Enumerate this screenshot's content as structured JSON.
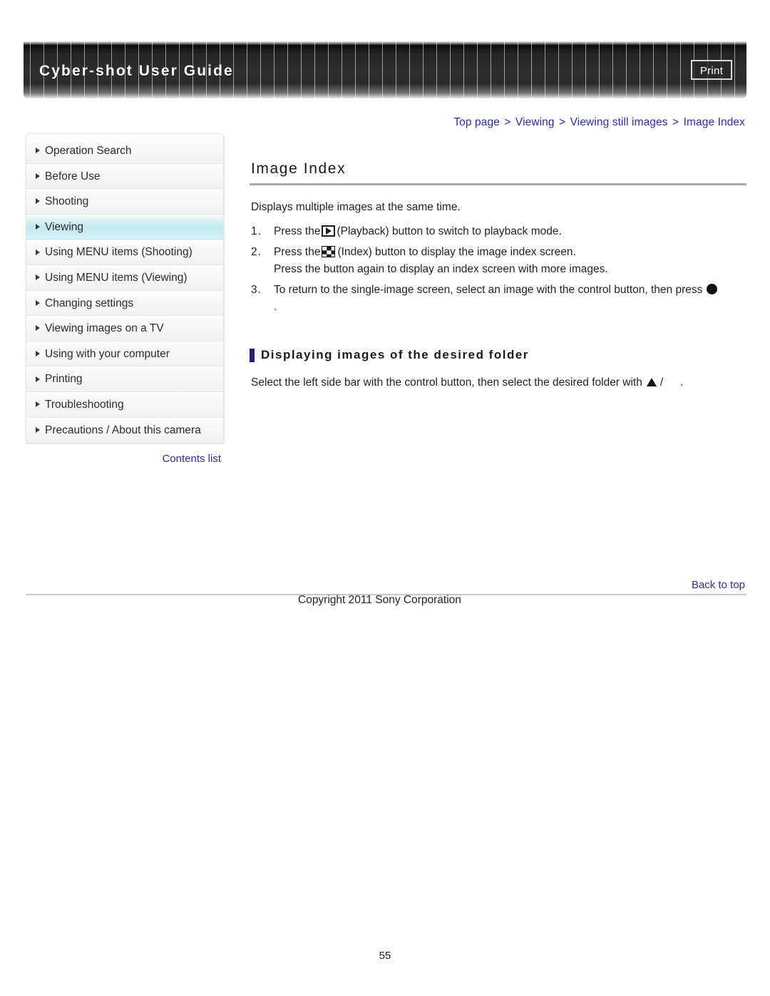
{
  "header": {
    "title": "Cyber-shot User Guide",
    "print_label": "Print"
  },
  "breadcrumb": {
    "items": [
      "Top page",
      "Viewing",
      "Viewing still images",
      "Image Index"
    ],
    "separator": ">"
  },
  "sidebar": {
    "items": [
      {
        "label": "Operation Search",
        "active": false
      },
      {
        "label": "Before Use",
        "active": false
      },
      {
        "label": "Shooting",
        "active": false
      },
      {
        "label": "Viewing",
        "active": true
      },
      {
        "label": "Using MENU items (Shooting)",
        "active": false
      },
      {
        "label": "Using MENU items (Viewing)",
        "active": false
      },
      {
        "label": "Changing settings",
        "active": false
      },
      {
        "label": "Viewing images on a TV",
        "active": false
      },
      {
        "label": "Using with your computer",
        "active": false
      },
      {
        "label": "Printing",
        "active": false
      },
      {
        "label": "Troubleshooting",
        "active": false
      },
      {
        "label": "Precautions / About this camera",
        "active": false
      }
    ],
    "contents_list_label": "Contents list"
  },
  "main": {
    "title": "Image Index",
    "intro": "Displays multiple images at the same time.",
    "steps": [
      {
        "number": "1.",
        "icon": "playback-icon",
        "text_before": "Press the",
        "text_after": "(Playback) button to switch to playback mode.",
        "sub": ""
      },
      {
        "number": "2.",
        "icon": "index-icon",
        "text_before": "Press the",
        "text_after": "(Index) button to display the image index screen.",
        "sub": "Press the button again to display an index screen with more images."
      },
      {
        "number": "3.",
        "icon": "center-button-icon",
        "text_before": "To return to the single-image screen, select an image with the control button, then press",
        "text_after": ".",
        "sub": ""
      }
    ],
    "subsection": {
      "heading": "Displaying images of the desired folder",
      "text_before": "Select the left side bar with the control button, then select the desired folder with",
      "icon_up": "up-triangle-icon",
      "slash": "/",
      "text_after": "."
    }
  },
  "footer": {
    "back_to_top": "Back to top",
    "copyright": "Copyright 2011 Sony Corporation",
    "page_number": "55"
  },
  "colors": {
    "link": "#2b2bb5",
    "accent_bar": "#202080",
    "active_nav": "#bfe9f0",
    "header_dark": "#2e2e2e"
  }
}
